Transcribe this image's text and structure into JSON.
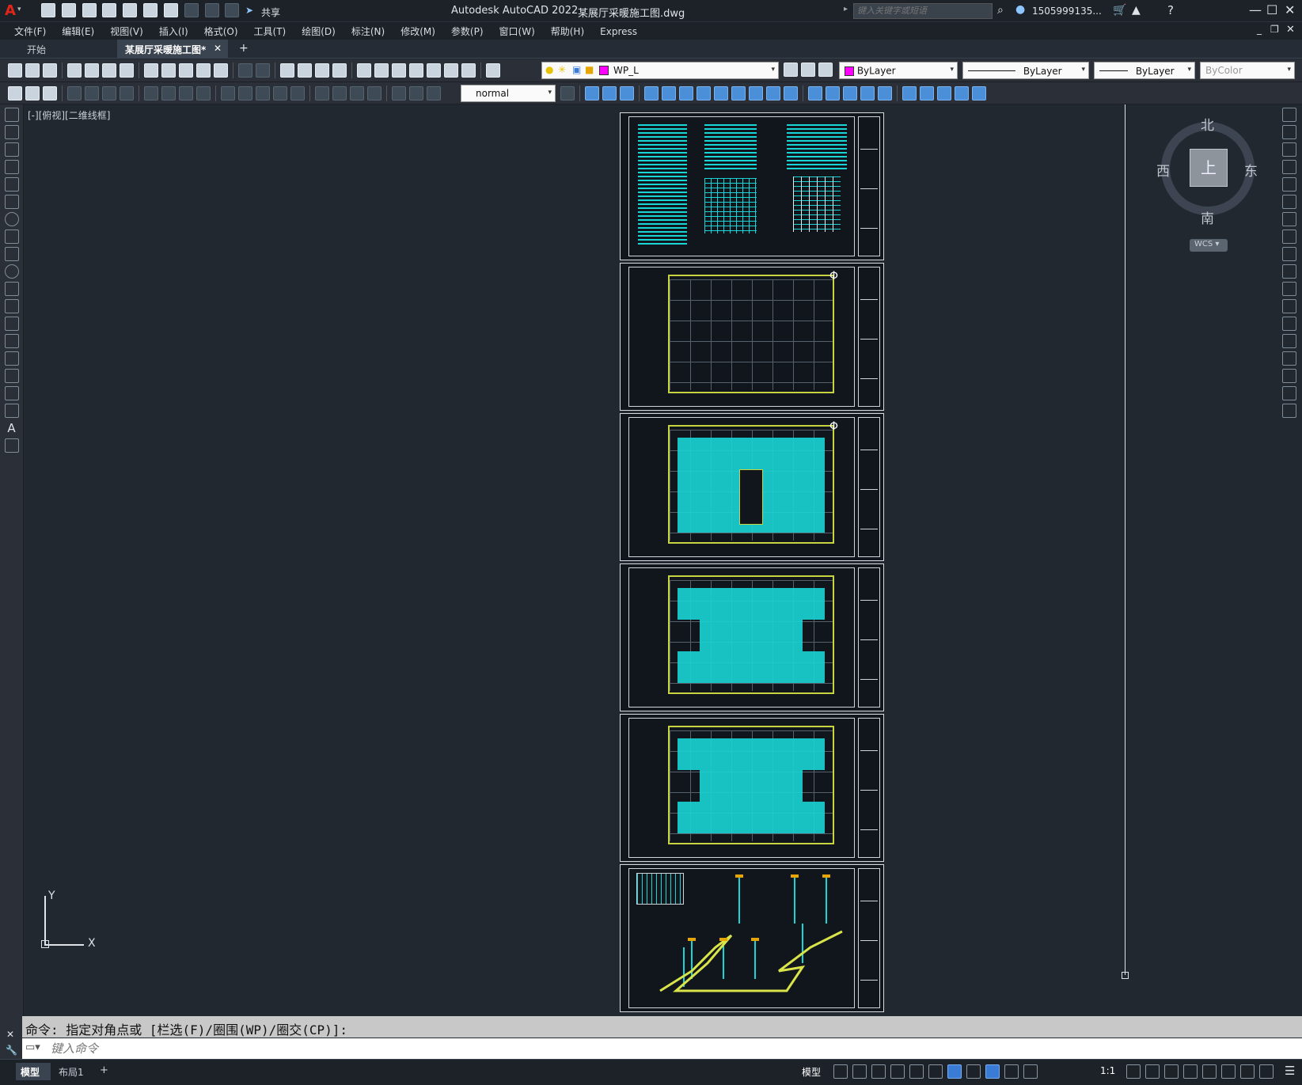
{
  "titlebar": {
    "app_title": "Autodesk AutoCAD 2022",
    "file_title": "某展厅采暖施工图.dwg",
    "share_label": "共享",
    "search_placeholder": "键入关键字或短语",
    "user_name": "1505999135..."
  },
  "menus": [
    "文件(F)",
    "编辑(E)",
    "视图(V)",
    "插入(I)",
    "格式(O)",
    "工具(T)",
    "绘图(D)",
    "标注(N)",
    "修改(M)",
    "参数(P)",
    "窗口(W)",
    "帮助(H)",
    "Express"
  ],
  "tabs": {
    "start_label": "开始",
    "active_doc_label": "某展厅采暖施工图*",
    "close_glyph": "✕",
    "add_glyph": "+"
  },
  "toolbar": {
    "layer_value": "WP_L",
    "color_value": "ByLayer",
    "linetype_value": "ByLayer",
    "lineweight_value": "ByLayer",
    "plotstyle_value": "ByColor",
    "dimstyle_value": "normal"
  },
  "viewport": {
    "label": "[-][俯视][二维线框]"
  },
  "viewcube": {
    "north": "北",
    "south": "南",
    "east": "东",
    "west": "西",
    "face": "上",
    "wcs_label": "WCS"
  },
  "ucs": {
    "y_label": "Y",
    "x_label": "X"
  },
  "command": {
    "history": "命令: 指定对角点或 [栏选(F)/圈围(WP)/圈交(CP)]:",
    "input_placeholder": "键入命令"
  },
  "statusbar": {
    "model_tab": "模型",
    "layout_tab": "布局1",
    "add_tab": "+",
    "model_label": "模型",
    "scale_label": "1:1"
  },
  "colors": {
    "accent": "#3a7bd5",
    "layer_swatch": "#ff00ff",
    "drawing_cyan": "#1ad5d5",
    "drawing_yellow": "#c7d43f"
  }
}
